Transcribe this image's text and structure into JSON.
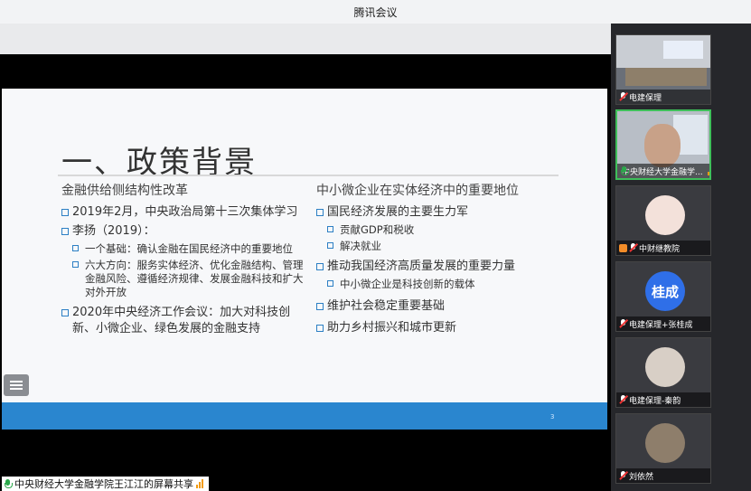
{
  "app": {
    "title": "腾讯会议"
  },
  "slide": {
    "heading": "一、政策背景",
    "left": {
      "subtitle": "金融供给侧结构性改革",
      "items": [
        {
          "text": "2019年2月，中央政治局第十三次集体学习"
        },
        {
          "text": "李扬（2019）："
        },
        {
          "text": "2020年中央经济工作会议：加大对科技创新、小微企业、绿色发展的金融支持"
        }
      ],
      "subitems": [
        {
          "text": "一个基础：确认金融在国民经济中的重要地位"
        },
        {
          "text": "六大方向：服务实体经济、优化金融结构、管理金融风险、遵循经济规律、发展金融科技和扩大对外开放"
        }
      ]
    },
    "right": {
      "subtitle": "中小微企业在实体经济中的重要地位",
      "items": [
        {
          "text": "国民经济发展的主要生力军"
        },
        {
          "text": "推动我国经济高质量发展的重要力量"
        },
        {
          "text": "维护社会稳定重要基础"
        },
        {
          "text": "助力乡村振兴和城市更新"
        }
      ],
      "subitems": [
        {
          "text": "贡献GDP和税收"
        },
        {
          "text": "解决就业"
        },
        {
          "text": "中小微企业是科技创新的载体"
        }
      ]
    },
    "page_number": "3"
  },
  "share": {
    "label": "中央财经大学金融学院王江江的屏幕共享"
  },
  "participants": [
    {
      "name": "电建保理",
      "avatar": ""
    },
    {
      "name": "中央财经大学金融学...",
      "avatar": ""
    },
    {
      "name": "中财继教院",
      "avatar": ""
    },
    {
      "name": "电建保理+张桂成",
      "avatar": "桂成"
    },
    {
      "name": "电建保理-秦韵",
      "avatar": ""
    },
    {
      "name": "刘依然",
      "avatar": ""
    }
  ],
  "colors": {
    "accent": "#2a86cf",
    "active_border": "#3fbf5a"
  }
}
